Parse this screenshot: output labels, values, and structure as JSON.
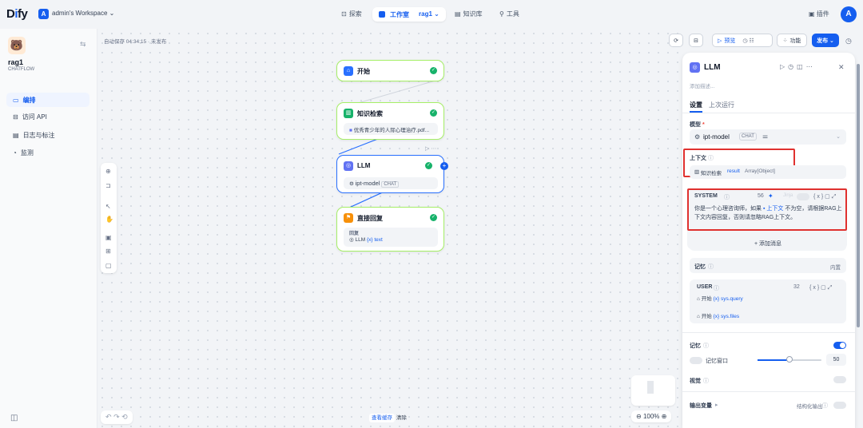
{
  "topbar": {
    "logo": "Dify",
    "workspace_badge": "A",
    "workspace_name": "admin's Workspace ⌄",
    "explore": "探索",
    "studio": "工作室",
    "app_tab": "rag1 ⌄",
    "knowledge": "知识库",
    "tools": "工具",
    "plugins": "插件",
    "avatar": "A"
  },
  "sidebar": {
    "app_name": "rag1",
    "app_type": "CHATFLOW",
    "items": [
      {
        "label": "编排"
      },
      {
        "label": "访问 API"
      },
      {
        "label": "日志与标注"
      },
      {
        "label": "监测"
      }
    ]
  },
  "canvas": {
    "autosave": "自动保存 04:34:15 · 未发布",
    "nodes": {
      "start": {
        "title": "开始"
      },
      "knowledge": {
        "title": "知识检索",
        "sub": "优秀青少年的人际心理治疗.pdf..."
      },
      "llm": {
        "title": "LLM",
        "model": "ipt-model",
        "badge": "CHAT"
      },
      "answer": {
        "title": "直接回复",
        "label": "回复",
        "var_node": "LLM",
        "var_name": "{x} text"
      }
    },
    "view_cache": "查看缓存",
    "clear": "清除",
    "zoom": "100%"
  },
  "toolbar": {
    "preview": "预览",
    "features": "功能",
    "publish": "发布 ⌄"
  },
  "panel": {
    "title": "LLM",
    "desc_placeholder": "添加描述...",
    "tabs": [
      "设置",
      "上次运行"
    ],
    "model_label": "模型",
    "model_name": "ipt-model",
    "model_badge": "CHAT",
    "context_label": "上下文",
    "context_node": "知识检索",
    "context_var": "result",
    "context_type": "Array[Object]",
    "system_label": "SYSTEM",
    "system_count": "56",
    "jinja": "Jinja",
    "system_text_1": "你是一个心理咨询师，如果",
    "system_pill": "上下文",
    "system_text_2": "不为空，请根据RAG上下文内容回复，否则请忽略RAG上下文。",
    "add_message": "+ 添加消息",
    "memory_label": "记忆",
    "memory_builtin": "内置",
    "user_label": "USER",
    "user_count": "32",
    "user_var1_node": "开始",
    "user_var1": "{x} sys.query",
    "user_var2_node": "开始",
    "user_var2": "{x} sys.files",
    "memory2_label": "记忆",
    "memory_window": "记忆窗口",
    "memory_window_value": "50",
    "vision_label": "视觉",
    "output_label": "输出变量",
    "structured_output": "结构化输出"
  }
}
